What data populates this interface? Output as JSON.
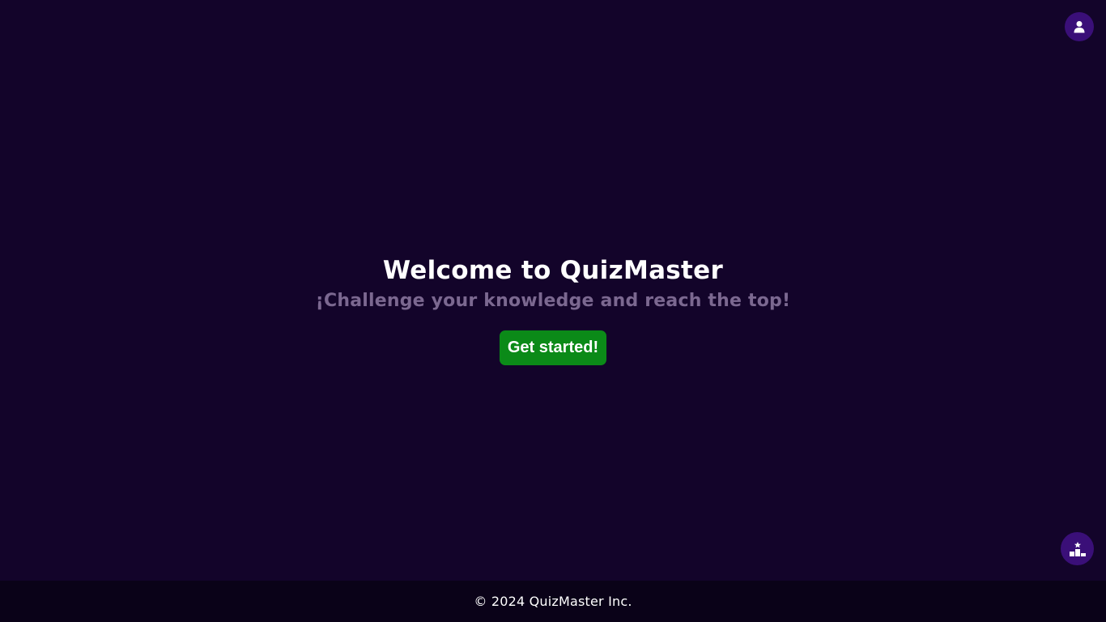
{
  "header": {
    "profile_icon": "user-icon"
  },
  "hero": {
    "title": "Welcome to QuizMaster",
    "subtitle": "¡Challenge your knowledge and reach the top!",
    "cta_label": "Get started!"
  },
  "floating": {
    "leaderboard_icon": "podium-icon"
  },
  "footer": {
    "text": "© 2024 QuizMaster Inc."
  },
  "colors": {
    "background": "#13042a",
    "accent": "#3a0f78",
    "cta": "#0b8a18",
    "footer_bg": "#0a0218",
    "subtitle": "#7b6890"
  }
}
